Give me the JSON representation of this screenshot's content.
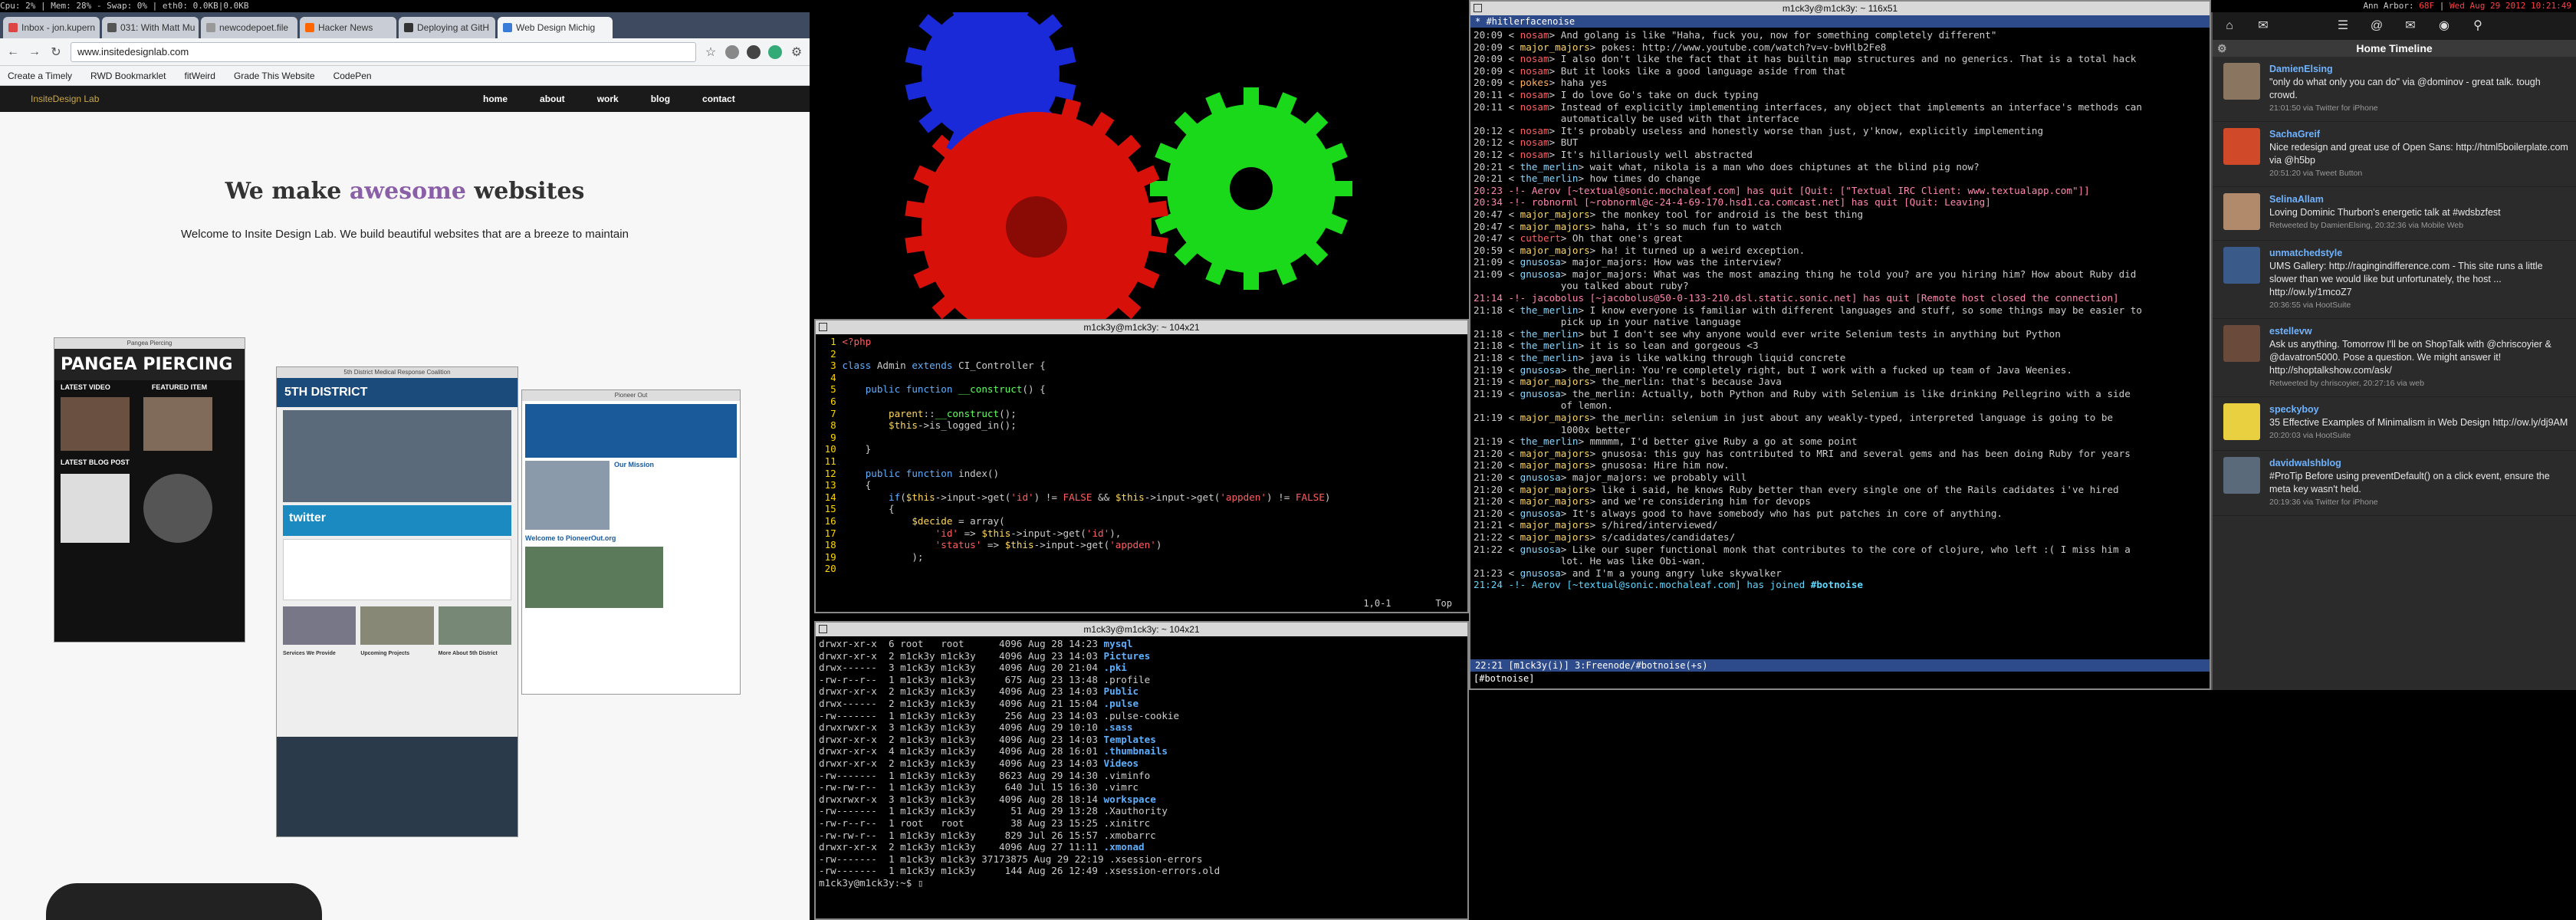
{
  "statusbar": {
    "left": "Cpu: 2% | Mem: 28% - Swap: 0% | eth0: 0.0KB|0.0KB",
    "right_location": "Ann Arbor:",
    "right_temp": "68F",
    "right_time": "Wed Aug 29 2012 10:21:49"
  },
  "browser": {
    "tabs": [
      "Inbox - jon.kupern",
      "031: With Matt Mu",
      "newcodepoet.file",
      "Hacker News",
      "Deploying at GitH",
      "Web Design Michig"
    ],
    "url": "www.insitedesignlab.com",
    "bookmarks": [
      "Create a Timely",
      "RWD Bookmarklet",
      "fitWeird",
      "Grade This Website",
      "CodePen"
    ],
    "site": {
      "logo": "InsiteDesign Lab",
      "nav": [
        "home",
        "about",
        "work",
        "blog",
        "contact"
      ],
      "h1_pre": "We make",
      "h1_accent": "awesome",
      "h1_post": "websites",
      "tagline": "Welcome to Insite Design Lab. We build beautiful websites that are a breeze to maintain",
      "shot1_title": "Pangea Piercing",
      "shot1_brand": "PANGEA PIERCING",
      "shot1_latest": "LATEST VIDEO",
      "shot1_featured": "FEATURED ITEM",
      "shot1_blog": "LATEST BLOG POST",
      "shot2_title": "5th District Medical Response Coalition",
      "shot2_brand": "5TH DISTRICT",
      "shot2_twitter": "twitter",
      "shot2_cols": [
        "Services We Provide",
        "Upcoming Projects",
        "More About 5th District"
      ],
      "shot3_title": "Pioneer Out",
      "shot3_mission": "Our Mission",
      "shot3_welcome": "Welcome to PioneerOut.org"
    }
  },
  "vim": {
    "title": "m1ck3y@m1ck3y: ~ 104x21",
    "status": "1,0-1        Top"
  },
  "ls": {
    "title": "m1ck3y@m1ck3y: ~ 104x21",
    "prompt": "m1ck3y@m1ck3y:~$ "
  },
  "irc": {
    "title": "m1ck3y@m1ck3y: ~ 116x51",
    "channel": "*  #hitlerfacenoise",
    "status": " 22:21  [m1ck3y(i)]  3:Freenode/#botnoise(+s)",
    "input": "[#botnoise] "
  },
  "hotot": {
    "header": "Home Timeline",
    "tweets": [
      {
        "name": "DamienElsing",
        "text": "\"only do what only you can do\" via @dominov - great talk. tough crowd.",
        "meta": "21:01:50 via Twitter for iPhone",
        "color": "#8a7560"
      },
      {
        "name": "SachaGreif",
        "text": "Nice redesign and great use of Open Sans: http://html5boilerplate.com via @h5bp",
        "meta": "20:51:20 via Tweet Button",
        "color": "#d04a2a"
      },
      {
        "name": "SelinaAllam",
        "text": "Loving Dominic Thurbon's energetic talk at #wdsbzfest",
        "meta": "Retweeted by DamienElsing, 20:32:36 via Mobile Web",
        "color": "#b08a6a"
      },
      {
        "name": "unmatchedstyle",
        "text": "UMS Gallery: http://ragingindifference.com - This site runs a little slower than we would like but unfortunately, the host ... http://ow.ly/1mcoZ7",
        "meta": "20:36:55 via HootSuite",
        "color": "#3a5a8a"
      },
      {
        "name": "estellevw",
        "text": "Ask us anything. Tomorrow I'll be on ShopTalk with @chriscoyier & @davatron5000. Pose a question. We might answer it! http://shoptalkshow.com/ask/",
        "meta": "Retweeted by chriscoyier, 20:27:16 via web",
        "color": "#6a4a3a"
      },
      {
        "name": "speckyboy",
        "text": "35 Effective Examples of Minimalism in Web Design http://ow.ly/dj9AM",
        "meta": "20:20:03 via HootSuite",
        "color": "#e8d040"
      },
      {
        "name": "davidwalshblog",
        "text": "#ProTip Before using preventDefault() on a click event, ensure the meta key wasn't held.",
        "meta": "20:19:36 via Twitter for iPhone",
        "color": "#5a6a7a"
      }
    ]
  }
}
